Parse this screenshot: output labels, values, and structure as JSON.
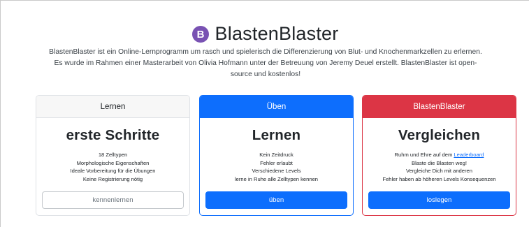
{
  "header": {
    "title": "BlastenBlaster",
    "logo_icon": "bootstrap-b-icon",
    "logo_letter": "B",
    "logo_color": "#7952b3"
  },
  "intro": "BlastenBlaster ist ein Online-Lernprogramm um rasch und spielerisch die Differenzierung von Blut- und Knochenmarkzellen zu erlernen. Es wurde im Rahmen einer Masterarbeit von Olivia Hofmann unter der Betreuung von Jeremy Deuel erstellt. BlastenBlaster ist open-source und kostenlos!",
  "colors": {
    "primary": "#0d6efd",
    "danger": "#dc3545",
    "light": "#f7f7f7"
  },
  "cards": [
    {
      "header": "Lernen",
      "title": "erste Schritte",
      "features": [
        "18 Zelltypen",
        "Morphologische Eigenschaften",
        "Ideale Vorbereitung für die Übungen",
        "Keine Registrierung nötig"
      ],
      "button": "kennenlernen"
    },
    {
      "header": "Üben",
      "title": "Lernen",
      "features": [
        "Kein Zeitdruck",
        "Fehler erlaubt",
        "Verschiedene Levels",
        "lerne in Ruhe alle Zelltypen kennen"
      ],
      "button": "üben"
    },
    {
      "header": "BlastenBlaster",
      "title": "Vergleichen",
      "feature_1_prefix": "Ruhm und Ehre auf dem ",
      "feature_1_link": "Leaderboard",
      "features": [
        "Blaste die Blasten weg!",
        "Vergleiche Dich mit anderen",
        "Fehler haben ab höheren Levels Konsequenzen"
      ],
      "button": "loslegen"
    }
  ]
}
